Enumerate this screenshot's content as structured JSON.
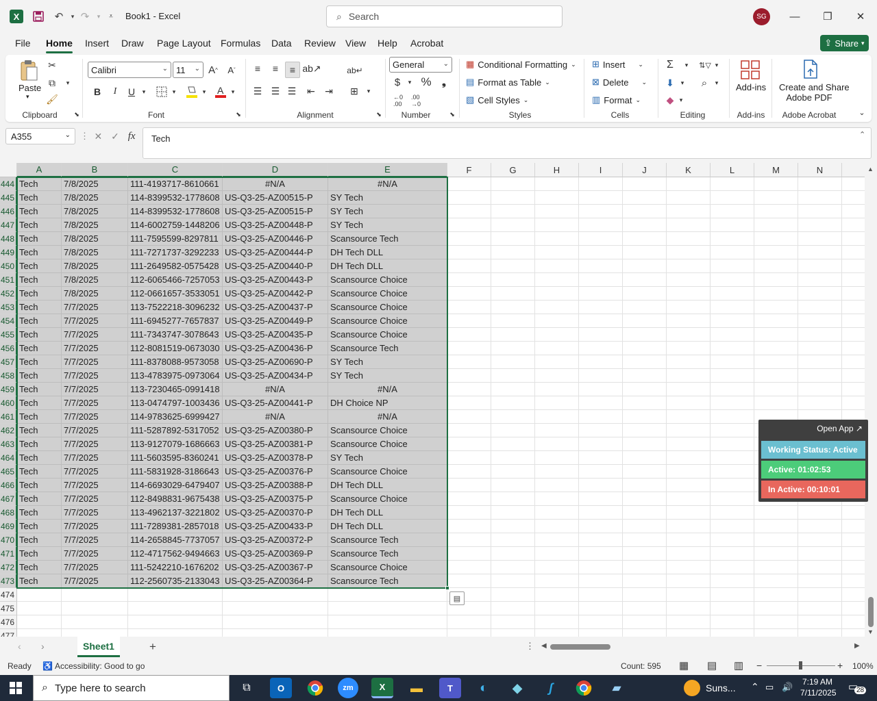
{
  "window": {
    "title": "Book1  -  Excel",
    "app_letter": "X",
    "search_placeholder": "Search",
    "avatar_initials": "SG"
  },
  "menu": {
    "tabs": [
      "File",
      "Home",
      "Insert",
      "Draw",
      "Page Layout",
      "Formulas",
      "Data",
      "Review",
      "View",
      "Help",
      "Acrobat"
    ],
    "active": "Home",
    "share_label": "Share"
  },
  "ribbon": {
    "clipboard": {
      "paste": "Paste",
      "label": "Clipboard"
    },
    "font": {
      "name": "Calibri",
      "size": "11",
      "label": "Font",
      "bold": "B",
      "italic": "I",
      "underline": "U"
    },
    "alignment": {
      "label": "Alignment"
    },
    "number": {
      "format": "General",
      "label": "Number",
      "currency": "$",
      "percent": "%"
    },
    "styles": {
      "conditional": "Conditional Formatting",
      "table": "Format as Table",
      "cell_styles": "Cell Styles",
      "label": "Styles"
    },
    "cells": {
      "insert": "Insert",
      "delete": "Delete",
      "format": "Format",
      "label": "Cells"
    },
    "editing": {
      "label": "Editing"
    },
    "addins": {
      "button": "Add-ins",
      "label": "Add-ins"
    },
    "acrobat": {
      "button_line1": "Create and Share",
      "button_line2": "Adobe PDF",
      "label": "Adobe Acrobat"
    }
  },
  "formula_bar": {
    "name_box": "A355",
    "fx": "fx",
    "content": "Tech"
  },
  "columns": [
    "A",
    "B",
    "C",
    "D",
    "E",
    "F",
    "G",
    "H",
    "I",
    "J",
    "K",
    "L",
    "M",
    "N"
  ],
  "rows": [
    {
      "n": "444",
      "a": "Tech",
      "b": "7/8/2025",
      "c": "111-4193717-8610661",
      "d": "#N/A",
      "e": "#N/A"
    },
    {
      "n": "445",
      "a": "Tech",
      "b": "7/8/2025",
      "c": "114-8399532-1778608",
      "d": "US-Q3-25-AZ00515-P",
      "e": "SY Tech"
    },
    {
      "n": "446",
      "a": "Tech",
      "b": "7/8/2025",
      "c": "114-8399532-1778608",
      "d": "US-Q3-25-AZ00515-P",
      "e": "SY Tech"
    },
    {
      "n": "447",
      "a": "Tech",
      "b": "7/8/2025",
      "c": "114-6002759-1448206",
      "d": "US-Q3-25-AZ00448-P",
      "e": "SY Tech"
    },
    {
      "n": "448",
      "a": "Tech",
      "b": "7/8/2025",
      "c": "111-7595599-8297811",
      "d": "US-Q3-25-AZ00446-P",
      "e": "Scansource Tech"
    },
    {
      "n": "449",
      "a": "Tech",
      "b": "7/8/2025",
      "c": "111-7271737-3292233",
      "d": "US-Q3-25-AZ00444-P",
      "e": "DH Tech DLL"
    },
    {
      "n": "450",
      "a": "Tech",
      "b": "7/8/2025",
      "c": "111-2649582-0575428",
      "d": "US-Q3-25-AZ00440-P",
      "e": "DH Tech DLL"
    },
    {
      "n": "451",
      "a": "Tech",
      "b": "7/8/2025",
      "c": "112-6065466-7257053",
      "d": "US-Q3-25-AZ00443-P",
      "e": "Scansource Choice"
    },
    {
      "n": "452",
      "a": "Tech",
      "b": "7/8/2025",
      "c": "112-0661657-3533051",
      "d": "US-Q3-25-AZ00442-P",
      "e": "Scansource Choice"
    },
    {
      "n": "453",
      "a": "Tech",
      "b": "7/7/2025",
      "c": "113-7522218-3096232",
      "d": "US-Q3-25-AZ00437-P",
      "e": "Scansource Choice"
    },
    {
      "n": "454",
      "a": "Tech",
      "b": "7/7/2025",
      "c": "111-6945277-7657837",
      "d": "US-Q3-25-AZ00449-P",
      "e": "Scansource Choice"
    },
    {
      "n": "455",
      "a": "Tech",
      "b": "7/7/2025",
      "c": "111-7343747-3078643",
      "d": "US-Q3-25-AZ00435-P",
      "e": "Scansource Choice"
    },
    {
      "n": "456",
      "a": "Tech",
      "b": "7/7/2025",
      "c": "112-8081519-0673030",
      "d": "US-Q3-25-AZ00436-P",
      "e": "Scansource Tech"
    },
    {
      "n": "457",
      "a": "Tech",
      "b": "7/7/2025",
      "c": "111-8378088-9573058",
      "d": "US-Q3-25-AZ00690-P",
      "e": "SY Tech"
    },
    {
      "n": "458",
      "a": "Tech",
      "b": "7/7/2025",
      "c": "113-4783975-0973064",
      "d": "US-Q3-25-AZ00434-P",
      "e": "SY Tech"
    },
    {
      "n": "459",
      "a": "Tech",
      "b": "7/7/2025",
      "c": "113-7230465-0991418",
      "d": "#N/A",
      "e": "#N/A"
    },
    {
      "n": "460",
      "a": "Tech",
      "b": "7/7/2025",
      "c": "113-0474797-1003436",
      "d": "US-Q3-25-AZ00441-P",
      "e": "DH Choice NP"
    },
    {
      "n": "461",
      "a": "Tech",
      "b": "7/7/2025",
      "c": "114-9783625-6999427",
      "d": "#N/A",
      "e": "#N/A"
    },
    {
      "n": "462",
      "a": "Tech",
      "b": "7/7/2025",
      "c": "111-5287892-5317052",
      "d": "US-Q3-25-AZ00380-P",
      "e": "Scansource Choice"
    },
    {
      "n": "463",
      "a": "Tech",
      "b": "7/7/2025",
      "c": "113-9127079-1686663",
      "d": "US-Q3-25-AZ00381-P",
      "e": "Scansource Choice"
    },
    {
      "n": "464",
      "a": "Tech",
      "b": "7/7/2025",
      "c": "111-5603595-8360241",
      "d": "US-Q3-25-AZ00378-P",
      "e": "SY Tech"
    },
    {
      "n": "465",
      "a": "Tech",
      "b": "7/7/2025",
      "c": "111-5831928-3186643",
      "d": "US-Q3-25-AZ00376-P",
      "e": "Scansource Choice"
    },
    {
      "n": "466",
      "a": "Tech",
      "b": "7/7/2025",
      "c": "114-6693029-6479407",
      "d": "US-Q3-25-AZ00388-P",
      "e": "DH Tech DLL"
    },
    {
      "n": "467",
      "a": "Tech",
      "b": "7/7/2025",
      "c": "112-8498831-9675438",
      "d": "US-Q3-25-AZ00375-P",
      "e": "Scansource Choice"
    },
    {
      "n": "468",
      "a": "Tech",
      "b": "7/7/2025",
      "c": "113-4962137-3221802",
      "d": "US-Q3-25-AZ00370-P",
      "e": "DH Tech DLL"
    },
    {
      "n": "469",
      "a": "Tech",
      "b": "7/7/2025",
      "c": "111-7289381-2857018",
      "d": "US-Q3-25-AZ00433-P",
      "e": "DH Tech DLL"
    },
    {
      "n": "470",
      "a": "Tech",
      "b": "7/7/2025",
      "c": "114-2658845-7737057",
      "d": "US-Q3-25-AZ00372-P",
      "e": "Scansource Tech"
    },
    {
      "n": "471",
      "a": "Tech",
      "b": "7/7/2025",
      "c": "112-4717562-9494663",
      "d": "US-Q3-25-AZ00369-P",
      "e": "Scansource Tech"
    },
    {
      "n": "472",
      "a": "Tech",
      "b": "7/7/2025",
      "c": "111-5242210-1676202",
      "d": "US-Q3-25-AZ00367-P",
      "e": "Scansource Choice"
    },
    {
      "n": "473",
      "a": "Tech",
      "b": "7/7/2025",
      "c": "112-2560735-2133043",
      "d": "US-Q3-25-AZ00364-P",
      "e": "Scansource Tech"
    },
    {
      "n": "474",
      "a": "",
      "b": "",
      "c": "",
      "d": "",
      "e": ""
    },
    {
      "n": "475",
      "a": "",
      "b": "",
      "c": "",
      "d": "",
      "e": ""
    },
    {
      "n": "476",
      "a": "",
      "b": "",
      "c": "",
      "d": "",
      "e": ""
    },
    {
      "n": "477",
      "a": "",
      "b": "",
      "c": "",
      "d": "",
      "e": ""
    }
  ],
  "widget": {
    "open_app": "Open App ↗",
    "status": "Working Status: Active",
    "active": "Active: 01:02:53",
    "inactive": "In Active: 00:10:01",
    "colors": {
      "status": "#6bbfd0",
      "active": "#4ccc7a",
      "inactive": "#e8675d"
    }
  },
  "sheets": {
    "tabs": [
      "Sheet1"
    ],
    "add": "+"
  },
  "status_bar": {
    "ready": "Ready",
    "accessibility": "Accessibility: Good to go",
    "count": "Count: 595",
    "zoom": "100%"
  },
  "taskbar": {
    "search_placeholder": "Type here to search",
    "weather": "Suns...",
    "time": "7:19 AM",
    "date": "7/11/2025",
    "notifications": "28"
  },
  "colors": {
    "accent": "#1d6f42",
    "selection": "#d0d0d0"
  }
}
